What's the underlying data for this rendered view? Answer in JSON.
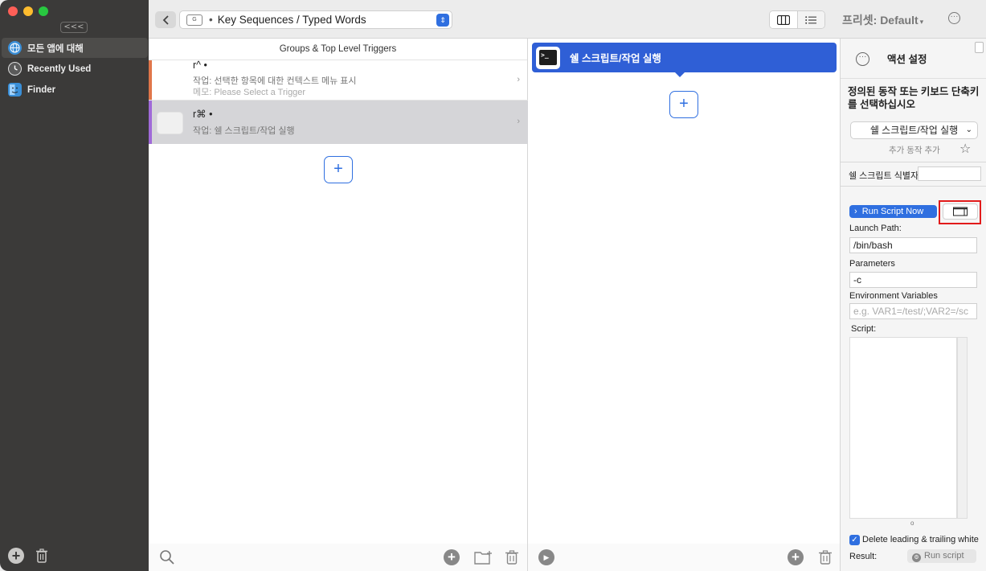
{
  "sidebar": {
    "collapse_label": "<<<",
    "items": [
      {
        "label": "모든 앱에 대해",
        "icon": "globe-icon",
        "color": "#3a8fd8"
      },
      {
        "label": "Recently Used",
        "icon": "clock-icon",
        "color": "#5a5a5a"
      },
      {
        "label": "Finder",
        "icon": "finder-icon",
        "color": "#3a8fd8"
      }
    ]
  },
  "toolbar": {
    "path_label": "Key Sequences / Typed Words",
    "preset_label": "프리셋: Default"
  },
  "triggers": {
    "header": "Groups & Top Level Triggers",
    "rows": [
      {
        "name": "r^ •",
        "action": "작업: 선택한 항목에 대한 컨텍스트 메뉴 표시",
        "memo": "메모: Please Select a Trigger",
        "stripe_color": "#e0764a"
      },
      {
        "name": "r⌘ •",
        "action": "작업: 쉘 스크립트/작업 실행",
        "stripe_color": "#a06ad8"
      }
    ],
    "add_label": "+"
  },
  "actions": {
    "items": [
      {
        "label": "쉘 스크립트/작업 실행",
        "icon": "terminal-icon"
      }
    ],
    "add_label": "+"
  },
  "settings": {
    "title": "액션 설정",
    "prompt": "정의된 동작 또는 키보드 단축키를 선택하십시오",
    "selected_action": "쉘 스크립트/작업 실행",
    "add_action_label": "추가 동작 추가",
    "identifier_label": "쉘 스크립트 식별자",
    "identifier_value": "",
    "run_now_label": "Run Script Now",
    "launch_path_label": "Launch Path:",
    "launch_path_value": "/bin/bash",
    "parameters_label": "Parameters",
    "parameters_value": "-c",
    "env_label": "Environment Variables",
    "env_placeholder": "e.g. VAR1=/test/;VAR2=/sc",
    "script_label": "Script:",
    "script_value": "",
    "trim_label": "Delete leading & trailing white",
    "trim_checked": true,
    "result_label": "Result:",
    "run_script_label": "Run script"
  },
  "colors": {
    "accent": "#2f6fe0",
    "action_selected": "#2f5fd6",
    "highlight_box": "#e21b1b",
    "sidebar_bg": "#3b3a39"
  }
}
